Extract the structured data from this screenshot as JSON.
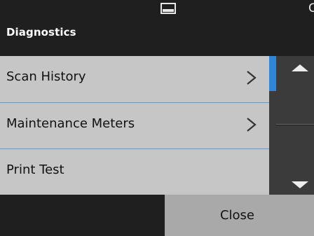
{
  "header": {
    "title": "Diagnostics",
    "corner_text": "C",
    "tray_icon": "paper-tray-icon"
  },
  "list": {
    "items": [
      {
        "label": "Scan History",
        "icon": "chevron-right-icon"
      },
      {
        "label": "Maintenance Meters",
        "icon": "chevron-right-icon"
      },
      {
        "label": "Print Test"
      }
    ]
  },
  "scroll": {
    "up_icon": "arrow-up-icon",
    "down_icon": "arrow-down-icon"
  },
  "footer": {
    "close_label": "Close"
  },
  "colors": {
    "background": "#1f1f1f",
    "list_bg": "#c6c6c6",
    "divider": "#5b9bd5",
    "scroll_thumb": "#2e86d8",
    "scroll_bg": "#3b3b3b",
    "button_bg": "#a9a9a9"
  }
}
